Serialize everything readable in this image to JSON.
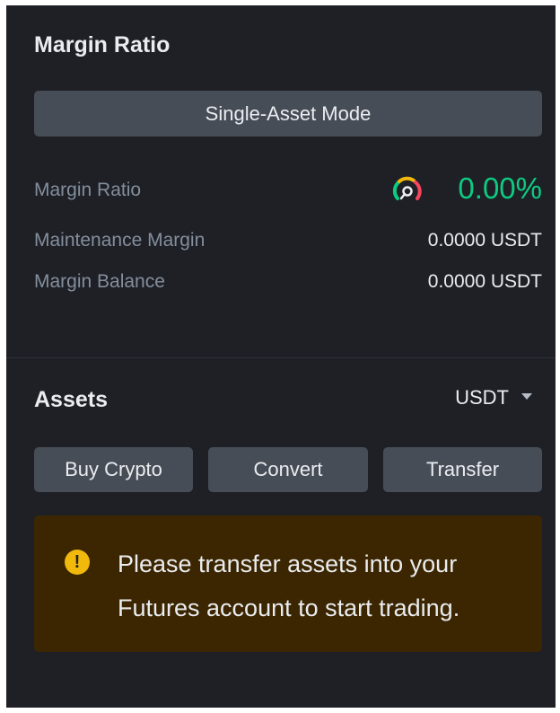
{
  "margin_section": {
    "title": "Margin Ratio",
    "mode_button": "Single-Asset Mode",
    "rows": [
      {
        "label": "Margin Ratio",
        "value": "0.00%"
      },
      {
        "label": "Maintenance Margin",
        "value": "0.0000 USDT"
      },
      {
        "label": "Margin Balance",
        "value": "0.0000 USDT"
      }
    ],
    "gauge_icon": "risk-gauge-icon"
  },
  "assets_section": {
    "title": "Assets",
    "currency_selected": "USDT",
    "dropdown_icon": "caret-down-icon",
    "buttons": [
      "Buy Crypto",
      "Convert",
      "Transfer"
    ]
  },
  "notice": {
    "icon": "warning-exclamation-icon",
    "text": "Please transfer assets into your Futures account to start trading."
  },
  "colors": {
    "background": "#1e2026",
    "button": "#474d57",
    "positive": "#0ecb81",
    "warning": "#f0b90b",
    "notice_bg": "#3c2601",
    "muted_text": "#848e9c"
  }
}
